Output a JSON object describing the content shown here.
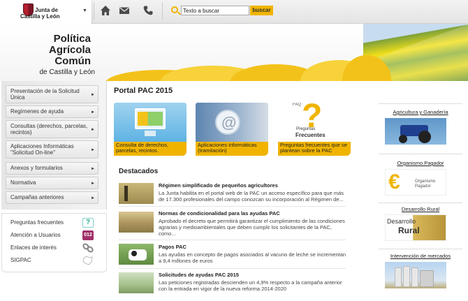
{
  "header": {
    "org_line1": "Junta de",
    "org_line2": "Castilla y León",
    "search": {
      "value": "Texto a buscar",
      "button_label": "buscar"
    }
  },
  "banner": {
    "title_line1": "Política Agrícola",
    "title_line2": "Común",
    "title_line3": "de Castilla y León"
  },
  "sidebar": {
    "items": [
      {
        "label": "Presentación de la Solicitud Única"
      },
      {
        "label": "Regímenes de ayuda"
      },
      {
        "label": "Consultas (derechos, parcelas, recintos)"
      },
      {
        "label": "Aplicaciones Informáticas \"Solicitud On-line\""
      },
      {
        "label": "Anexos y formularios"
      },
      {
        "label": "Normativa"
      },
      {
        "label": "Campañas anteriores"
      }
    ],
    "utilities": [
      {
        "label": "Preguntas frecuentes",
        "icon": "question-icon"
      },
      {
        "label": "Atención a Usuarios",
        "icon": "012-phone-icon"
      },
      {
        "label": "Enlaces de interés",
        "icon": "chain-link-icon"
      },
      {
        "label": "SIGPAC",
        "icon": "map-icon"
      }
    ]
  },
  "main": {
    "title": "Portal PAC 2015",
    "tiles": [
      {
        "caption": "Consulta de derechos, parcelas, recintos."
      },
      {
        "caption": "Aplicaciones informáticas (tramitación)"
      },
      {
        "caption": "Preguntas frecuentes que se plantean sobre la PAC",
        "img_text_top": "FAQ",
        "img_text_mid": "Preguntas",
        "img_text_bot": "Frecuentes"
      }
    ],
    "destacados_title": "Destacados",
    "news": [
      {
        "title": "Régimen simplificado de pequeños agricultores",
        "body": "La Junta habilita en el portal web de la PAC un acceso específico para que más de 17.300 profesionales del campo conozcan su incorporación al Régimen de..."
      },
      {
        "title": "Normas de condicionalidad para las ayudas PAC",
        "body": "Aprobado el decreto que permitirá garantizar el cumplimiento de las condiciones agrarias y medioambientales que deben cumplir los solicitantes de la PAC, como..."
      },
      {
        "title": "Pagos PAC",
        "body": "Las ayudas en concepto de pagos asociados al vacuno de leche se incrementan a 9,4 millones de euros"
      },
      {
        "title": "Solicitudes de ayudas PAC 2015",
        "body": "Las peticiones registradas descienden un 4,9% respecto a la campaña anterior con la entrada en vigor de la nueva reforma 2014-2020"
      }
    ]
  },
  "right": {
    "links": [
      {
        "label": "Agricultura y Ganadería"
      },
      {
        "label": "Organismo Pagador",
        "img_text": "Organismo Pagador"
      },
      {
        "label": "Desarrollo Rural",
        "img_text1": "Desarrollo",
        "img_text2": "Rural"
      },
      {
        "label": "Intervención de mercados"
      }
    ]
  },
  "colors": {
    "accent": "#f0b400",
    "text": "#222222",
    "crest_red": "#b51f2e"
  }
}
